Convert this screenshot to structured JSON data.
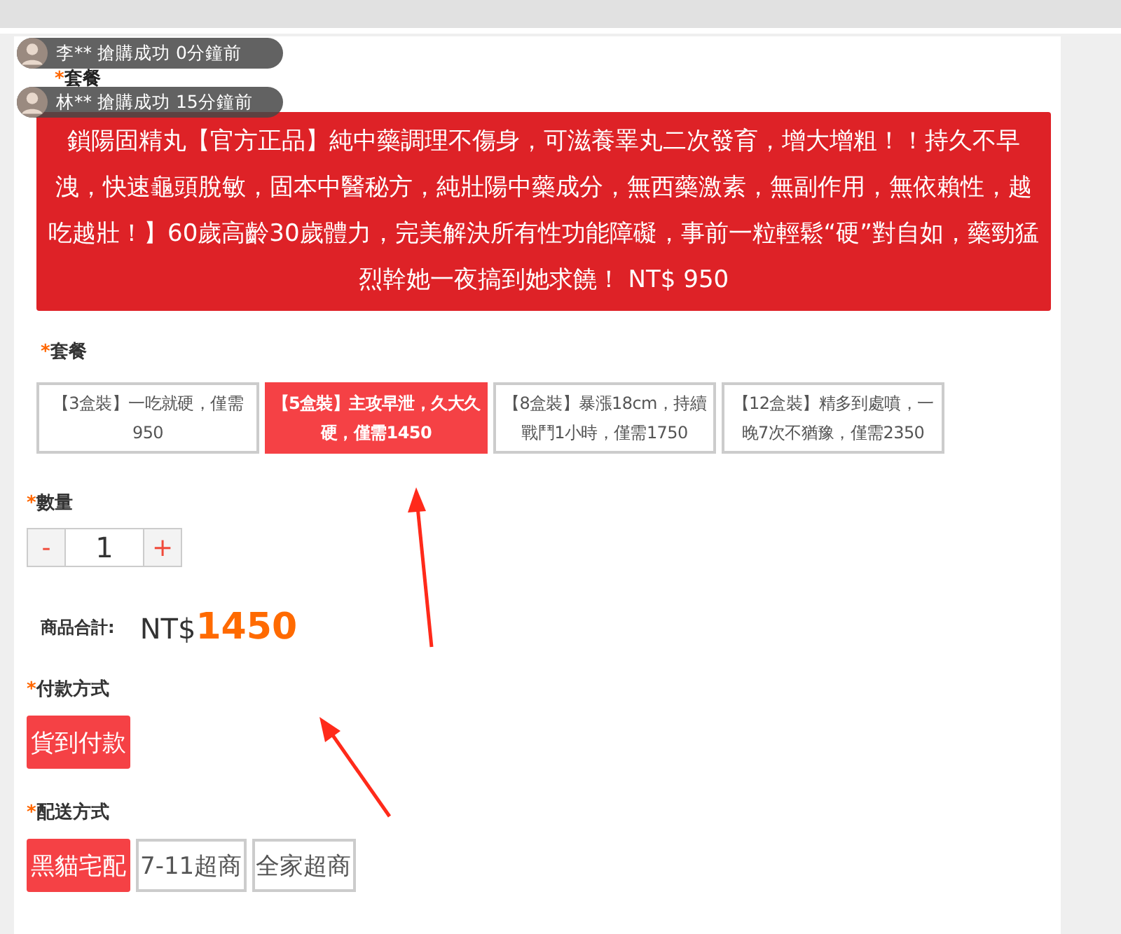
{
  "toasts": [
    {
      "text": "李** 搶購成功 0分鐘前"
    },
    {
      "text": "林** 搶購成功 15分鐘前"
    }
  ],
  "covered_label": {
    "mark": "*",
    "label": "套餐"
  },
  "title": "鎖陽固精丸【官方正品】純中藥調理不傷身，可滋養睪丸二次發育，增大增粗！！持久不早洩，快速龜頭脫敏，固本中醫秘方，純壯陽中藥成分，無西藥激素，無副作用，無依賴性，越吃越壯！】60歲高齡30歲體力，完美解決所有性功能障礙，事前一粒輕鬆“硬”對自如，藥勁猛烈幹她一夜搞到她求饒！ NT$ 950",
  "package": {
    "mark": "*",
    "label": "套餐",
    "options": [
      {
        "text": "【3盒裝】一吃就硬，僅需950",
        "selected": false
      },
      {
        "text": "【5盒裝】主攻早泄，久大久硬，僅需1450",
        "selected": true
      },
      {
        "text": "【8盒裝】暴漲18cm，持續戰鬥1小時，僅需1750",
        "selected": false
      },
      {
        "text": "【12盒裝】精多到處噴，一晚7次不猶豫，僅需2350",
        "selected": false
      }
    ]
  },
  "quantity": {
    "mark": "*",
    "label": "數量",
    "minus": "-",
    "value": "1",
    "plus": "+"
  },
  "total": {
    "label": "商品合計:",
    "currency": "NT$",
    "amount": "1450"
  },
  "payment": {
    "mark": "*",
    "label": "付款方式",
    "options": [
      {
        "text": "貨到付款",
        "selected": true
      }
    ]
  },
  "delivery": {
    "mark": "*",
    "label": "配送方式",
    "options": [
      {
        "text": "黑貓宅配",
        "selected": true
      },
      {
        "text": "7-11超商",
        "selected": false
      },
      {
        "text": "全家超商",
        "selected": false
      }
    ]
  }
}
